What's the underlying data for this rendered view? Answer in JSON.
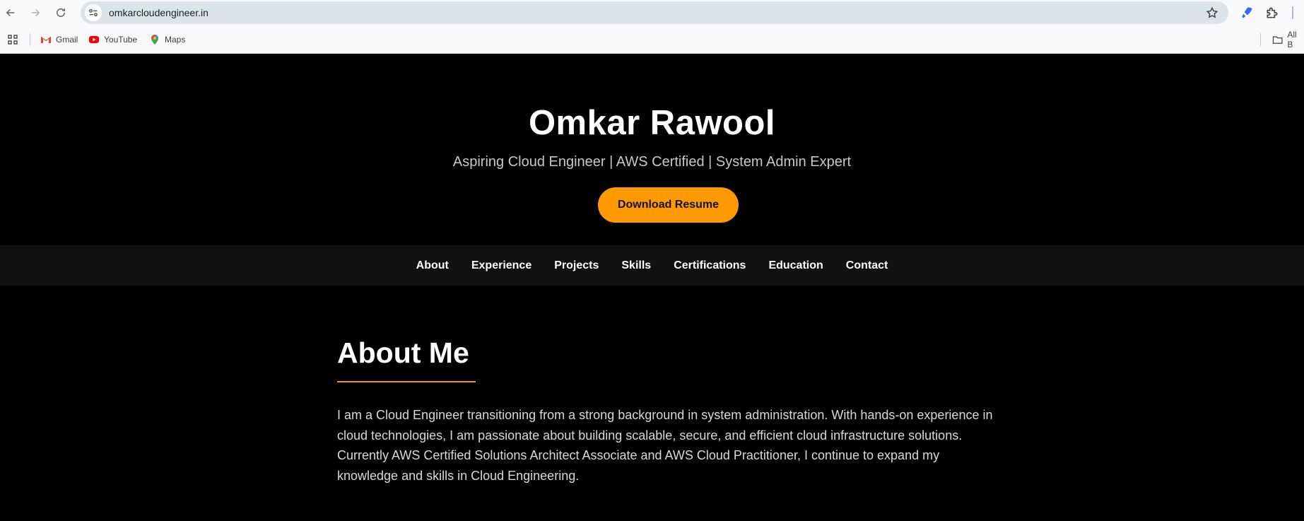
{
  "browser": {
    "url": "omkarcloudengineer.in",
    "bookmarks": [
      {
        "label": "Gmail",
        "icon": "gmail-icon"
      },
      {
        "label": "YouTube",
        "icon": "youtube-icon"
      },
      {
        "label": "Maps",
        "icon": "maps-icon"
      }
    ],
    "all_bookmarks_label": "All B"
  },
  "hero": {
    "name": "Omkar Rawool",
    "tagline": "Aspiring Cloud Engineer | AWS Certified | System Admin Expert",
    "download_label": "Download Resume"
  },
  "nav": {
    "items": [
      "About",
      "Experience",
      "Projects",
      "Skills",
      "Certifications",
      "Education",
      "Contact"
    ]
  },
  "about": {
    "heading": "About Me",
    "body": "I am a Cloud Engineer transitioning from a strong background in system administration. With hands-on experience in cloud technologies, I am passionate about building scalable, secure, and efficient cloud infrastructure solutions. Currently AWS Certified Solutions Architect Associate and AWS Cloud Practitioner, I continue to expand my knowledge and skills in Cloud Engineering."
  },
  "colors": {
    "accent": "#ff9900",
    "background": "#000000",
    "nav_background": "#111111"
  }
}
